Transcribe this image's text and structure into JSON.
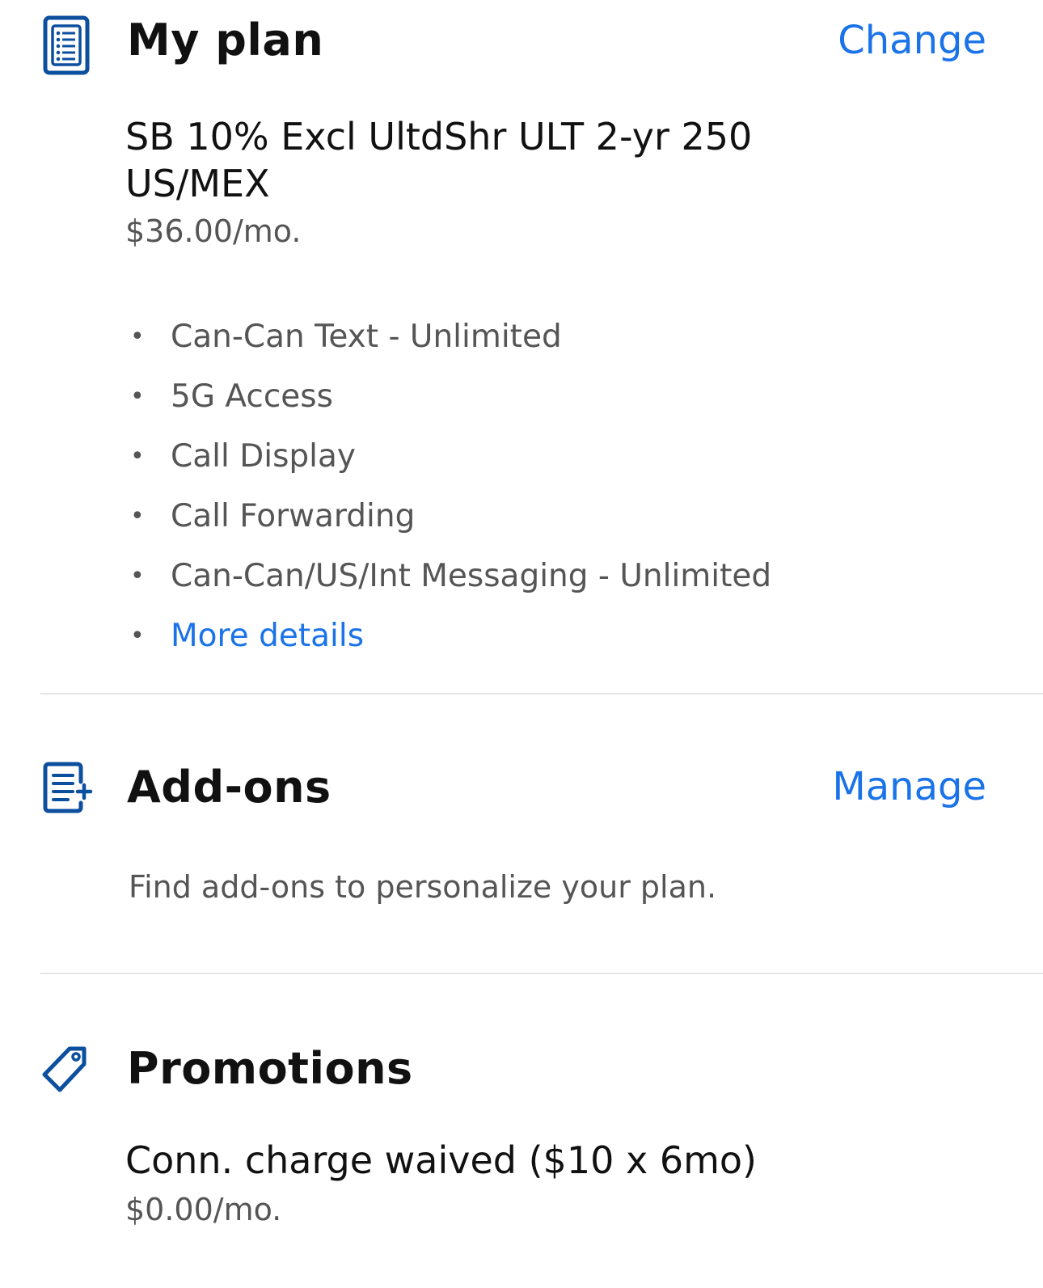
{
  "colors": {
    "accent": "#1a73e8",
    "icon": "#0b4f9e",
    "heading": "#111111",
    "secondary_text": "#555555",
    "divider": "#e6e6e6"
  },
  "my_plan": {
    "icon": "list-document-icon",
    "title": "My plan",
    "action_label": "Change",
    "plan_name": "SB 10% Excl UltdShr ULT 2-yr 250 US/MEX",
    "price": "$36.00/mo.",
    "features": [
      "Can-Can Text - Unlimited",
      "5G Access",
      "Call Display",
      "Call Forwarding",
      "Can-Can/US/Int Messaging - Unlimited"
    ],
    "more_details_label": "More details",
    "bullet": "•"
  },
  "addons": {
    "icon": "document-add-icon",
    "title": "Add-ons",
    "action_label": "Manage",
    "description": "Find add-ons to personalize your plan."
  },
  "promotions": {
    "icon": "tag-icon",
    "title": "Promotions",
    "promo_name": "Conn. charge waived ($10 x 6mo)",
    "promo_price": "$0.00/mo."
  }
}
